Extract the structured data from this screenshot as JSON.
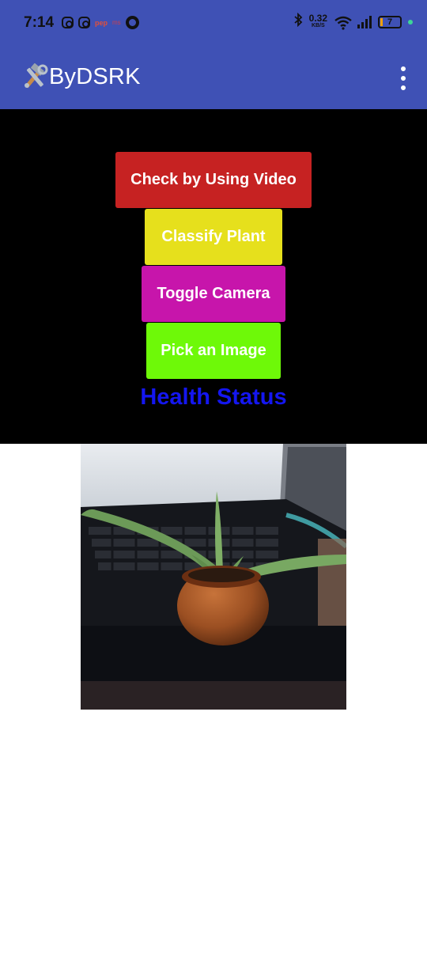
{
  "status_bar": {
    "time": "7:14",
    "net_speed_value": "0.32",
    "net_speed_unit": "KB/S",
    "battery_level": "7",
    "mini_label_1": "pep",
    "mini_label_2": "ms"
  },
  "app_bar": {
    "title": "ByDSRK",
    "logo_icon": "hammer-wrench-icon",
    "menu_icon": "more-vert-icon"
  },
  "actions": {
    "check_video_label": "Check by Using Video",
    "classify_label": "Classify Plant",
    "toggle_camera_label": "Toggle Camera",
    "pick_image_label": "Pick an Image"
  },
  "result": {
    "health_status": "Health Status"
  },
  "colors": {
    "app_bar": "#3f51b5",
    "check_video": "#c62222",
    "classify": "#e6e01c",
    "toggle_camera": "#c715ab",
    "pick_image": "#6ef908",
    "health_status": "#1416f0"
  }
}
